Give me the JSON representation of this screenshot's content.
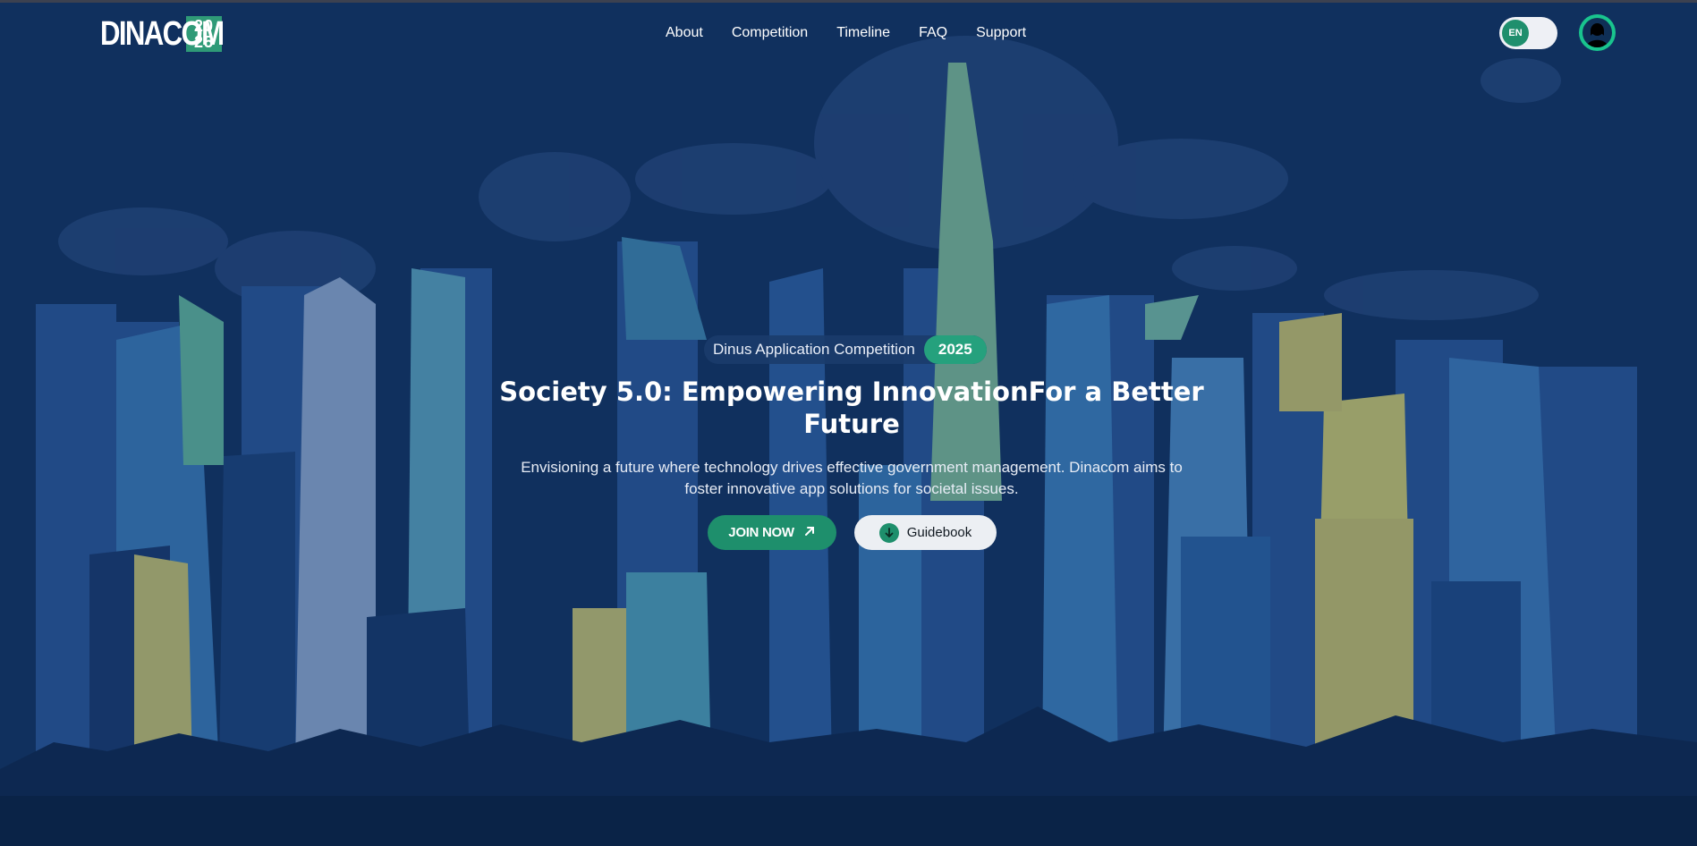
{
  "header": {
    "logo_word": "DINACOM",
    "logo_year_top": "20",
    "logo_year_bottom": "25",
    "nav": [
      {
        "label": "About"
      },
      {
        "label": "Competition"
      },
      {
        "label": "Timeline"
      },
      {
        "label": "FAQ"
      },
      {
        "label": "Support"
      }
    ],
    "lang": "EN"
  },
  "hero": {
    "badge_text": "Dinus Application Competition",
    "badge_year": "2025",
    "headline": "Society 5.0: Empowering InnovationFor a Better Future",
    "description": "Envisioning a future where technology drives effective government management. Dinacom aims to foster innovative app solutions for societal issues.",
    "join_label": "JOIN NOW",
    "guide_label": "Guidebook"
  },
  "colors": {
    "background": "#123566",
    "accent": "#1e8f6c",
    "accent_light": "#19c48e"
  },
  "icons": {
    "join": "arrow-up-right-icon",
    "guide": "download-icon",
    "avatar": "user-icon"
  }
}
